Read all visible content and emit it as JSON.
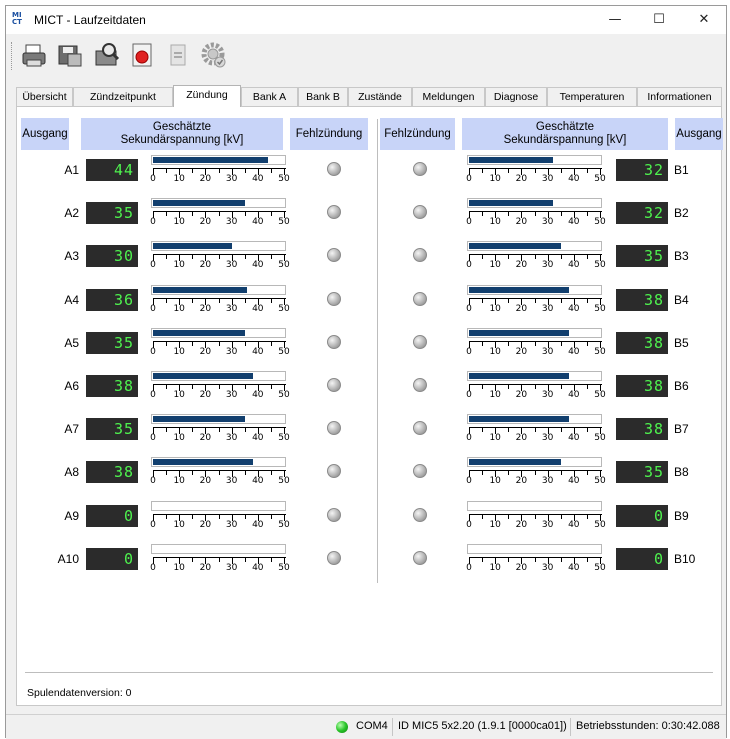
{
  "window": {
    "title": "MICT - Laufzeitdaten",
    "icon_text": "MI CT",
    "minimize": "—",
    "maximize": "☐",
    "close": "✕"
  },
  "toolbar": {
    "buttons": [
      "printer-icon",
      "save-disk-icon",
      "zoom-document-icon",
      "record-icon",
      "document-icon",
      "settings-gear-icon"
    ]
  },
  "tabs": [
    "Übersicht",
    "Zündzeitpunkt",
    "Zündung",
    "Bank A",
    "Bank B",
    "Zustände",
    "Meldungen",
    "Diagnose",
    "Temperaturen",
    "Informationen"
  ],
  "active_tab": "Zündung",
  "headers": {
    "output": "Ausgang",
    "voltage": "Geschätzte\nSekundärspannung [kV]",
    "misfire": "Fehlzündung"
  },
  "scale": {
    "min": 0,
    "max": 50,
    "ticks": [
      "0",
      "10",
      "20",
      "30",
      "40",
      "50"
    ]
  },
  "bank_a": [
    {
      "label": "A1",
      "value": "44",
      "fraction": 0.88
    },
    {
      "label": "A2",
      "value": "35",
      "fraction": 0.7
    },
    {
      "label": "A3",
      "value": "30",
      "fraction": 0.6
    },
    {
      "label": "A4",
      "value": "36",
      "fraction": 0.72
    },
    {
      "label": "A5",
      "value": "35",
      "fraction": 0.7
    },
    {
      "label": "A6",
      "value": "38",
      "fraction": 0.76
    },
    {
      "label": "A7",
      "value": "35",
      "fraction": 0.7
    },
    {
      "label": "A8",
      "value": "38",
      "fraction": 0.76
    },
    {
      "label": "A9",
      "value": "0",
      "fraction": 0.0
    },
    {
      "label": "A10",
      "value": "0",
      "fraction": 0.0
    }
  ],
  "bank_b": [
    {
      "label": "B1",
      "value": "32",
      "fraction": 0.64
    },
    {
      "label": "B2",
      "value": "32",
      "fraction": 0.64
    },
    {
      "label": "B3",
      "value": "35",
      "fraction": 0.7
    },
    {
      "label": "B4",
      "value": "38",
      "fraction": 0.76
    },
    {
      "label": "B5",
      "value": "38",
      "fraction": 0.76
    },
    {
      "label": "B6",
      "value": "38",
      "fraction": 0.76
    },
    {
      "label": "B7",
      "value": "38",
      "fraction": 0.76
    },
    {
      "label": "B8",
      "value": "35",
      "fraction": 0.7
    },
    {
      "label": "B9",
      "value": "0",
      "fraction": 0.0
    },
    {
      "label": "B10",
      "value": "0",
      "fraction": 0.0
    }
  ],
  "footer": {
    "coil_data_version": "Spulendatenversion:  0"
  },
  "status": {
    "led_color": "#28c428",
    "port": "COM4",
    "device_id": "ID MIC5 5x2.20 (1.9.1 [0000ca01])",
    "operating_hours": "Betriebsstunden: 0:30:42.088"
  }
}
